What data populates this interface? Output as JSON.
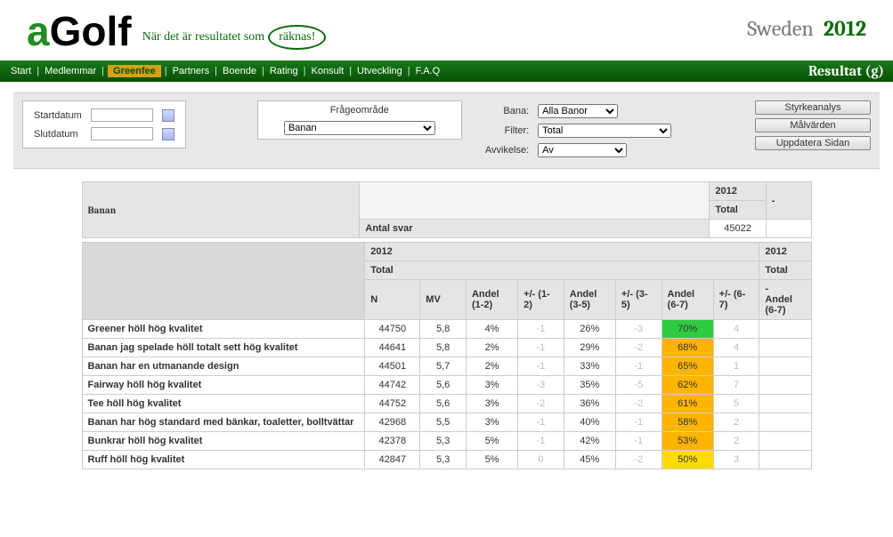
{
  "header": {
    "logo_a": "a",
    "logo_golf": "Golf",
    "tagline_pre": "När det är resultatet som",
    "tagline_circle": "räknas!",
    "region": "Sweden",
    "year": "2012"
  },
  "nav": {
    "start": "Start",
    "medlemmar": "Medlemmar",
    "greenfee": "Greenfee",
    "partners": "Partners",
    "boende": "Boende",
    "rating": "Rating",
    "konsult": "Konsult",
    "utveckling": "Utveckling",
    "faq": "F.A.Q",
    "result": "Resultat (g)"
  },
  "filters": {
    "start_label": "Startdatum",
    "end_label": "Slutdatum",
    "start_value": "",
    "end_value": "",
    "area_title": "Frågeområde",
    "area_value": "Banan",
    "bana_label": "Bana:",
    "bana_value": "Alla Banor",
    "filter_label": "Filter:",
    "filter_value": "Total",
    "avvikelse_label": "Avvikelse:",
    "avvikelse_value": "Av"
  },
  "buttons": {
    "styrke": "Styrkeanalys",
    "mal": "Målvärden",
    "uppdatera": "Uppdatera Sidan"
  },
  "summary": {
    "section": "Banan",
    "col_year": "2012",
    "col_total": "Total",
    "dash": "-",
    "antal_svar_label": "Antal svar",
    "antal_svar_value": "45022"
  },
  "table": {
    "year": "2012",
    "total": "Total",
    "dash": "-",
    "h_n": "N",
    "h_mv": "MV",
    "h_a12": "Andel (1-2)",
    "h_p12": "+/- (1-2)",
    "h_a35": "Andel (3-5)",
    "h_p35": "+/- (3-5)",
    "h_a67": "Andel (6-7)",
    "h_p67": "+/- (6-7)",
    "h_a67b": "Andel (6-7)",
    "rows": [
      {
        "label": "Greener höll hög kvalitet",
        "n": "44750",
        "mv": "5,8",
        "a12": "4%",
        "p12": "-1",
        "a35": "26%",
        "p35": "-3",
        "a67": "70%",
        "a67_cls": "green",
        "p67": "4"
      },
      {
        "label": "Banan jag spelade höll totalt sett hög kvalitet",
        "n": "44641",
        "mv": "5,8",
        "a12": "2%",
        "p12": "-1",
        "a35": "29%",
        "p35": "-2",
        "a67": "68%",
        "a67_cls": "orange",
        "p67": "4"
      },
      {
        "label": "Banan har en utmanande design",
        "n": "44501",
        "mv": "5,7",
        "a12": "2%",
        "p12": "-1",
        "a35": "33%",
        "p35": "-1",
        "a67": "65%",
        "a67_cls": "orange",
        "p67": "1"
      },
      {
        "label": "Fairway höll hög kvalitet",
        "n": "44742",
        "mv": "5,6",
        "a12": "3%",
        "p12": "-3",
        "a35": "35%",
        "p35": "-5",
        "a67": "62%",
        "a67_cls": "orange",
        "p67": "7"
      },
      {
        "label": "Tee höll hög kvalitet",
        "n": "44752",
        "mv": "5,6",
        "a12": "3%",
        "p12": "-2",
        "a35": "36%",
        "p35": "-2",
        "a67": "61%",
        "a67_cls": "orange",
        "p67": "5"
      },
      {
        "label": "Banan har hög standard med bänkar, toaletter, bolltvättar",
        "n": "42968",
        "mv": "5,5",
        "a12": "3%",
        "p12": "-1",
        "a35": "40%",
        "p35": "-1",
        "a67": "58%",
        "a67_cls": "orange",
        "p67": "2"
      },
      {
        "label": "Bunkrar höll hög kvalitet",
        "n": "42378",
        "mv": "5,3",
        "a12": "5%",
        "p12": "-1",
        "a35": "42%",
        "p35": "-1",
        "a67": "53%",
        "a67_cls": "orange",
        "p67": "2"
      },
      {
        "label": "Ruff höll hög kvalitet",
        "n": "42847",
        "mv": "5,3",
        "a12": "5%",
        "p12": "0",
        "a35": "45%",
        "p35": "-2",
        "a67": "50%",
        "a67_cls": "yellow",
        "p67": "3"
      }
    ]
  }
}
